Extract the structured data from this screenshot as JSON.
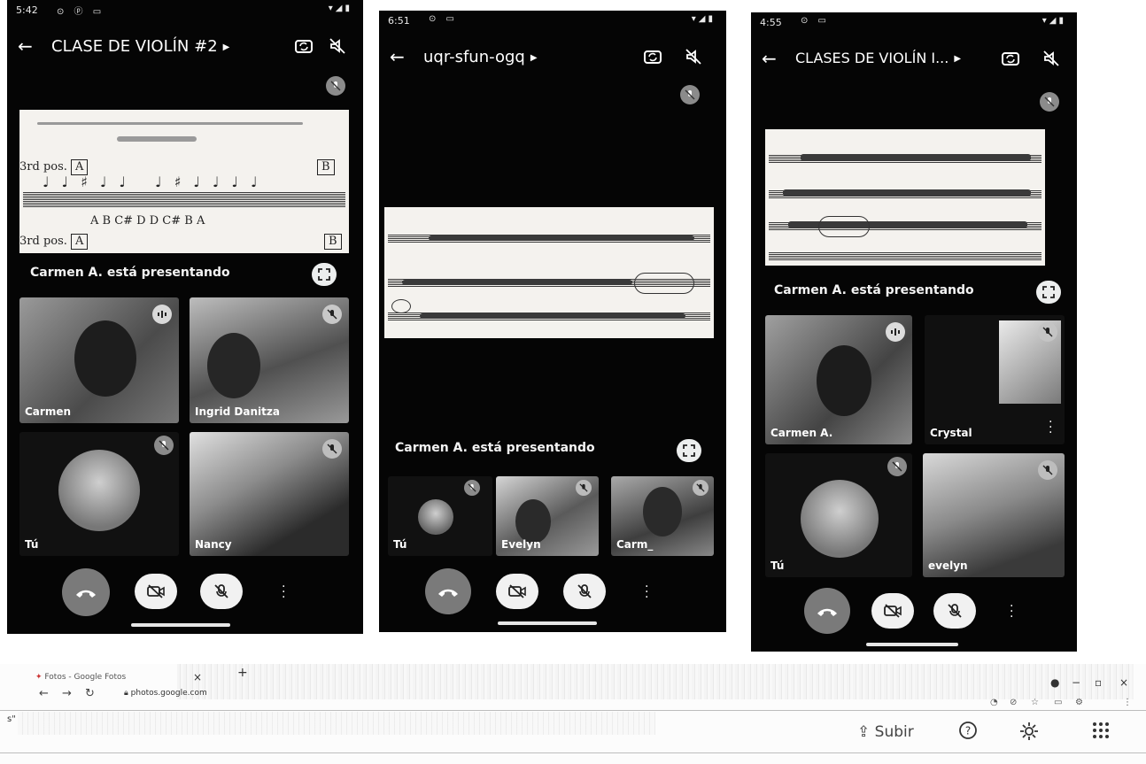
{
  "screenshots": [
    {
      "status_time": "5:42",
      "title": "CLASE DE VIOLÍN #2",
      "score_texts": {
        "pos_label": "3rd pos.",
        "box_a": "A",
        "box_b": "B",
        "note_names": "A  B  C#   D     D  C#  B   A",
        "lower_pos": "3rd pos.",
        "lower_box_a": "A",
        "lower_box_b": "B"
      },
      "presenting_text": "Carmen A. está presentando",
      "tiles": [
        {
          "name": "Carmen"
        },
        {
          "name": "Ingrid Danitza"
        },
        {
          "name": "Nancy"
        }
      ],
      "self_label": "Tú"
    },
    {
      "status_time": "6:51",
      "title": "uqr-sfun-ogq",
      "presenting_text": "Carmen A. está presentando",
      "tiles": [
        {
          "name": "Evelyn"
        },
        {
          "name": "Carm_"
        }
      ],
      "self_label": "Tú"
    },
    {
      "status_time": "4:55",
      "title": "CLASES DE VIOLÍN I...",
      "presenting_text": "Carmen A. está presentando",
      "tiles": [
        {
          "name": "Carmen A."
        },
        {
          "name": "Crystal"
        },
        {
          "name": "evelyn"
        }
      ],
      "self_label": "Tú"
    }
  ],
  "browser": {
    "tab_title": "Fotos - Google Fotos",
    "url": "photos.google.com",
    "upload_label": "Subir",
    "left_fragment": "s\""
  },
  "colors": {
    "meet_background": "#050505",
    "end_call": "#7a7a7a",
    "control_button": "#f1f1f1"
  }
}
